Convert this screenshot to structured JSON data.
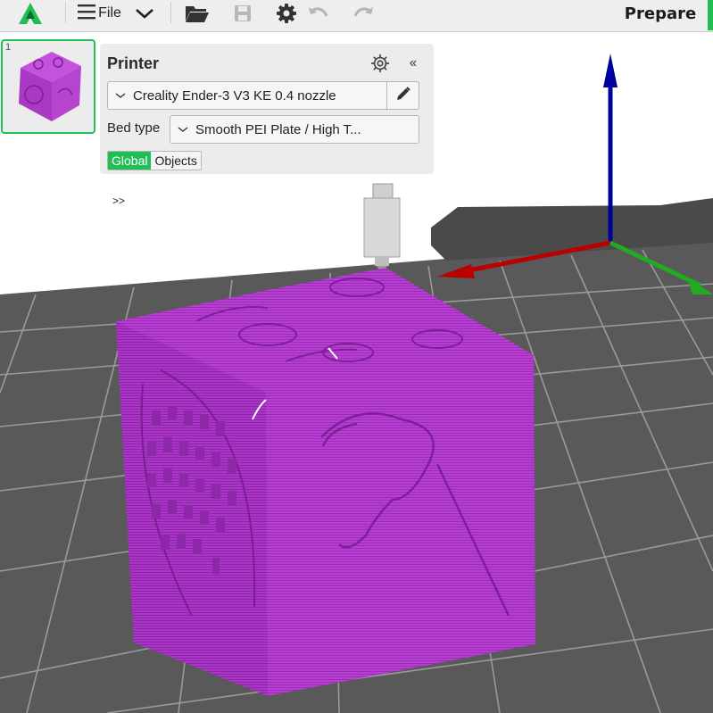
{
  "toolbar": {
    "file_label": "File",
    "tab_label": "Prepare",
    "icons": [
      "app-logo-icon",
      "hamburger-menu-icon",
      "chevron-down-icon",
      "open-folder-icon",
      "save-icon",
      "settings-gear-icon",
      "undo-icon",
      "redo-icon"
    ]
  },
  "plate": {
    "number": "1"
  },
  "printer_panel": {
    "title": "Printer",
    "printer_name": "Creality Ender-3 V3 KE 0.4 nozzle",
    "bed_type_label": "Bed type",
    "bed_type_value": "Smooth PEI Plate / High T...",
    "scope_options": [
      "Global",
      "Objects"
    ],
    "scope_selected": "Global"
  },
  "expand_label": ">>",
  "colors": {
    "accent": "#1fbf55",
    "model": "#b33bd0",
    "bed": "#555555",
    "axis_x": "#cc0000",
    "axis_y": "#22aa22",
    "axis_z": "#00009e"
  }
}
